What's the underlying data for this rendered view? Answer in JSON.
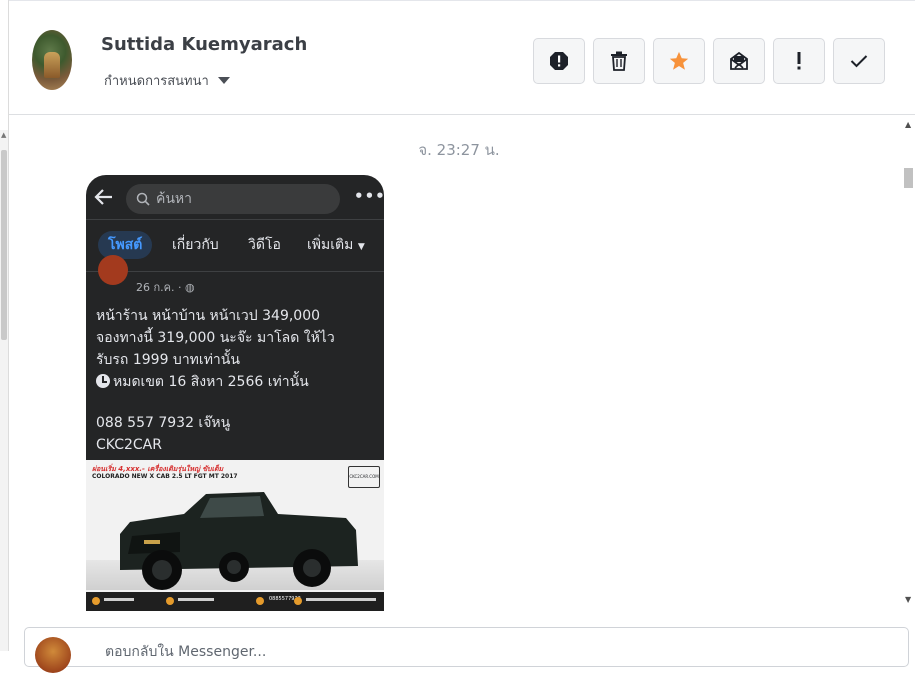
{
  "contact": {
    "name": "Suttida Kuemyarach",
    "settings_label": "กำหนดการสนทนา"
  },
  "toolbar": {
    "buttons": [
      {
        "name": "report-spam",
        "icon": "exclamation-octagon-icon"
      },
      {
        "name": "delete",
        "icon": "trash-icon"
      },
      {
        "name": "star",
        "icon": "star-icon",
        "color": "#f7923b"
      },
      {
        "name": "mark-unread",
        "icon": "envelope-x-icon"
      },
      {
        "name": "mark-important",
        "icon": "exclamation-icon"
      },
      {
        "name": "mark-done",
        "icon": "checkmark-icon"
      }
    ]
  },
  "conversation": {
    "timestamp": "จ. 23:27 น."
  },
  "shared_post": {
    "search_placeholder": "ค้นหา",
    "tabs": [
      "โพสต์",
      "เกี่ยวกับ",
      "วิดีโอ",
      "เพิ่มเติม"
    ],
    "date": "26 ก.ค. · ",
    "lines": [
      "หน้าร้าน หน้าบ้าน หน้าเวป 349,000",
      "จองทางนี้ 319,000 นะจ๊ะ มาโลด ให้ไว",
      "รับรถ 1999 บาทเท่านั้น",
      "หมดเขต 16 สิงหา 2566 เท่านั้น"
    ],
    "contact_lines": [
      "088 557 7932 เจ๊หนู",
      "CKC2CAR"
    ],
    "ad": {
      "headline": "ผ่อนเริ่ม 4,xxx.- เครื่องเดิมรุ่นใหญ่ ขับเต็ม",
      "model": "COLORADO NEW X CAB 2.5 LT FGT MT 2017",
      "logo_text": "CKC2CAR.COM",
      "phone": "0885577932"
    }
  },
  "composer": {
    "hint": "ตอบกลับใน Messenger..."
  },
  "colors": {
    "accent_star": "#f7923b",
    "post_bg": "#242526",
    "active_tab": "#4599ff"
  }
}
